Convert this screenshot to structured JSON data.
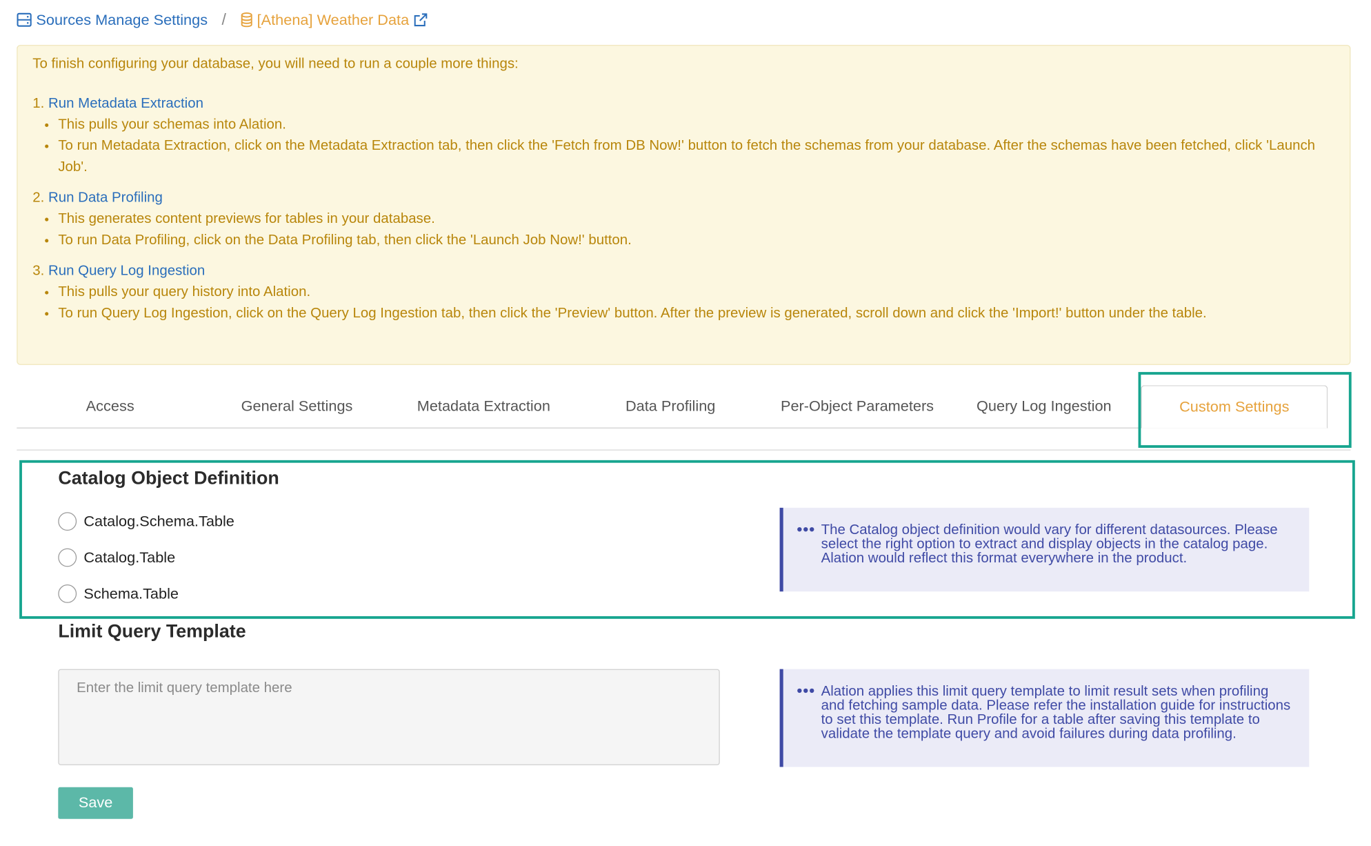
{
  "breadcrumb": {
    "parent": "Sources Manage Settings",
    "separator": "/",
    "current": "[Athena] Weather Data",
    "parent_icon": "server-icon",
    "current_icon": "database-icon",
    "external_icon": "external-link-icon"
  },
  "notice": {
    "intro": "To finish configuring your database, you will need to run a couple more things:",
    "steps": [
      {
        "num": "1.",
        "title": "Run Metadata Extraction",
        "bullets": [
          "This pulls your schemas into Alation.",
          "To run Metadata Extraction, click on the Metadata Extraction tab, then click the 'Fetch from DB Now!' button to fetch the schemas from your database. After the schemas have been fetched, click 'Launch Job'."
        ]
      },
      {
        "num": "2.",
        "title": "Run Data Profiling",
        "bullets": [
          "This generates content previews for tables in your database.",
          "To run Data Profiling, click on the Data Profiling tab, then click the 'Launch Job Now!' button."
        ]
      },
      {
        "num": "3.",
        "title": "Run Query Log Ingestion",
        "bullets": [
          "This pulls your query history into Alation.",
          "To run Query Log Ingestion, click on the Query Log Ingestion tab, then click the 'Preview' button. After the preview is generated, scroll down and click the 'Import!' button under the table."
        ]
      }
    ]
  },
  "tabs": [
    "Access",
    "General Settings",
    "Metadata Extraction",
    "Data Profiling",
    "Per-Object Parameters",
    "Query Log Ingestion",
    "Custom Settings"
  ],
  "active_tab": "Custom Settings",
  "catalog": {
    "title": "Catalog Object Definition",
    "options": [
      "Catalog.Schema.Table",
      "Catalog.Table",
      "Schema.Table"
    ],
    "info": "The Catalog object definition would vary for different datasources. Please select the right option to extract and display objects in the catalog page. Alation would reflect this format everywhere in the product."
  },
  "limit_query": {
    "title": "Limit Query Template",
    "placeholder": "Enter the limit query template here",
    "value": "",
    "info": "Alation applies this limit query template to limit result sets when profiling and fetching sample data. Please refer the installation guide for instructions to set this template. Run Profile for a table after saving this template to validate the template query and avoid failures during data profiling."
  },
  "save_label": "Save",
  "colors": {
    "link": "#2a6ebb",
    "active_tab": "#e6a23c",
    "notice_bg": "#fcf7e0",
    "notice_text": "#b8860b",
    "highlight": "#17a58f",
    "info_bg": "#ebebf7",
    "info_text": "#3f4aa5",
    "save_button": "#5cb8a8"
  }
}
